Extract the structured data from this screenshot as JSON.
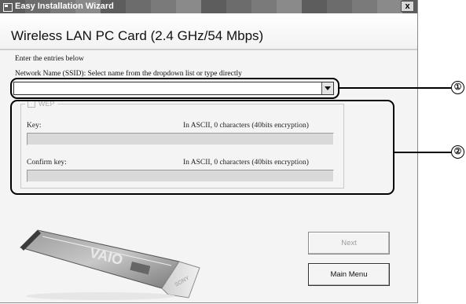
{
  "window": {
    "title": "Easy Installation Wizard",
    "close_label": "x",
    "heading": "Wireless LAN PC Card (2.4 GHz/54 Mbps)"
  },
  "form": {
    "instructions": "Enter the entries below",
    "ssid_label": "Network Name (SSID): Select name from the dropdown list or type directly",
    "ssid_value": "",
    "wep_label": "WEP",
    "wep_checked": false,
    "key_label": "Key:",
    "key_info": "In ASCII, 0 characters (40bits encryption)",
    "confirm_label": "Confirm key:",
    "confirm_info": "In ASCII, 0 characters (40bits encryption)"
  },
  "buttons": {
    "next": "Next",
    "main_menu": "Main Menu"
  },
  "callouts": [
    "①",
    "②"
  ],
  "illustration": {
    "brand_logo": "VAIO",
    "label_text": "SONY"
  }
}
